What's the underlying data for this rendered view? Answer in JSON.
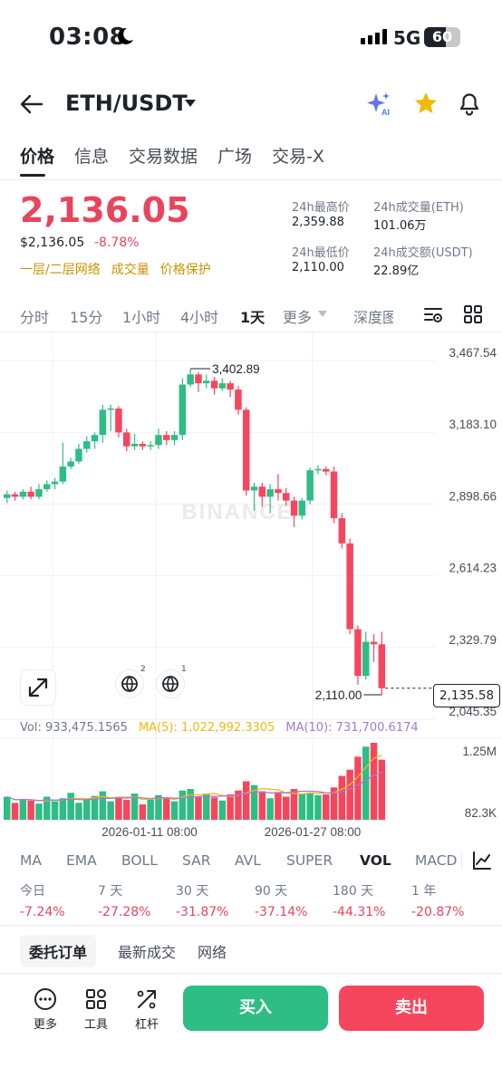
{
  "status_bar": {
    "time": "03:08",
    "network": "5G",
    "battery": "60",
    "battery_level": 0.6
  },
  "header": {
    "pair": "ETH/USDT"
  },
  "tabs": [
    {
      "label": "价格",
      "active": true
    },
    {
      "label": "信息"
    },
    {
      "label": "交易数据"
    },
    {
      "label": "广场"
    },
    {
      "label": "交易-X"
    }
  ],
  "price": {
    "last": "2,136.05",
    "usd": "$2,136.05",
    "change": "-8.78%",
    "tags": [
      "一层/二层网络",
      "成交量",
      "价格保护"
    ]
  },
  "stats": {
    "high_label": "24h最高价",
    "high": "2,359.88",
    "vol_eth_label": "24h成交量(ETH)",
    "vol_eth": "101.06万",
    "low_label": "24h最低价",
    "low": "2,110.00",
    "vol_usdt_label": "24h成交额(USDT)",
    "vol_usdt": "22.89亿"
  },
  "timeframes": [
    "分时",
    "15分",
    "1小时",
    "4小时",
    "1天",
    "更多",
    "深度图"
  ],
  "active_timeframe": "1天",
  "chart_data": {
    "type": "candlestick",
    "interval": "1天",
    "y_ticks": [
      "3,467.54",
      "3,183.10",
      "2,898.66",
      "2,614.23",
      "2,329.79",
      "2,045.35"
    ],
    "ylim": [
      2045.35,
      3467.54
    ],
    "x_ticks": [
      "2026-01-11 08:00",
      "2026-01-27 08:00"
    ],
    "high_marker": "3,402.89",
    "low_marker": "2,110.00",
    "current_price": "2,135.58",
    "watermark": "BINANCE",
    "candles": [
      [
        2890,
        2905,
        2870,
        2920
      ],
      [
        2905,
        2895,
        2880,
        2915
      ],
      [
        2895,
        2915,
        2885,
        2925
      ],
      [
        2915,
        2895,
        2885,
        2935
      ],
      [
        2895,
        2925,
        2885,
        2945
      ],
      [
        2925,
        2945,
        2915,
        2960
      ],
      [
        2945,
        2955,
        2925,
        2970
      ],
      [
        2955,
        3015,
        2945,
        3110
      ],
      [
        3015,
        3035,
        3005,
        3050
      ],
      [
        3035,
        3085,
        3025,
        3105
      ],
      [
        3085,
        3115,
        3070,
        3135
      ],
      [
        3115,
        3140,
        3085,
        3150
      ],
      [
        3140,
        3240,
        3110,
        3260
      ],
      [
        3240,
        3245,
        3155,
        3260
      ],
      [
        3245,
        3150,
        3130,
        3255
      ],
      [
        3150,
        3095,
        3075,
        3165
      ],
      [
        3095,
        3105,
        3080,
        3145
      ],
      [
        3105,
        3095,
        3080,
        3115
      ],
      [
        3095,
        3100,
        3080,
        3115
      ],
      [
        3100,
        3140,
        3085,
        3165
      ],
      [
        3140,
        3120,
        3100,
        3155
      ],
      [
        3120,
        3140,
        3100,
        3155
      ],
      [
        3140,
        3340,
        3120,
        3365
      ],
      [
        3340,
        3380,
        3330,
        3402.89
      ],
      [
        3380,
        3345,
        3310,
        3390
      ],
      [
        3345,
        3355,
        3325,
        3380
      ],
      [
        3355,
        3325,
        3300,
        3370
      ],
      [
        3325,
        3345,
        3315,
        3365
      ],
      [
        3345,
        3320,
        3290,
        3355
      ],
      [
        3320,
        3240,
        3220,
        3335
      ],
      [
        3240,
        2920,
        2900,
        3250
      ],
      [
        2920,
        2935,
        2840,
        2950
      ],
      [
        2935,
        2895,
        2855,
        2950
      ],
      [
        2895,
        2925,
        2830,
        2945
      ],
      [
        2925,
        2910,
        2880,
        2985
      ],
      [
        2910,
        2880,
        2860,
        2930
      ],
      [
        2880,
        2820,
        2775,
        2895
      ],
      [
        2820,
        2880,
        2805,
        2890
      ],
      [
        2880,
        3000,
        2865,
        3010
      ],
      [
        3000,
        3005,
        2985,
        3020
      ],
      [
        3005,
        2995,
        2980,
        3015
      ],
      [
        2995,
        2810,
        2790,
        3015
      ],
      [
        2810,
        2710,
        2690,
        2830
      ],
      [
        2710,
        2370,
        2350,
        2730
      ],
      [
        2370,
        2185,
        2150,
        2385
      ],
      [
        2185,
        2320,
        2170,
        2360
      ],
      [
        2320,
        2310,
        2240,
        2350
      ],
      [
        2310,
        2136.05,
        2110,
        2359.88
      ]
    ],
    "volume_ticks": [
      "1.25M",
      "82.3K"
    ],
    "volumes": [
      0.3,
      0.22,
      0.27,
      0.25,
      0.21,
      0.3,
      0.24,
      0.28,
      0.35,
      0.22,
      0.27,
      0.31,
      0.37,
      0.24,
      0.28,
      0.26,
      0.34,
      0.2,
      0.26,
      0.32,
      0.29,
      0.24,
      0.38,
      0.4,
      0.3,
      0.34,
      0.29,
      0.25,
      0.33,
      0.38,
      0.5,
      0.45,
      0.37,
      0.28,
      0.35,
      0.3,
      0.4,
      0.34,
      0.35,
      0.32,
      0.33,
      0.42,
      0.57,
      0.65,
      0.82,
      0.95,
      1.0,
      0.78
    ],
    "volume_max_label": "1.25M"
  },
  "indicators": {
    "vol": "Vol: 933,475.1565",
    "ma5": "MA(5): 1,022,992.3305",
    "ma10": "MA(10): 731,700.6174"
  },
  "indicator_tabs": [
    "MA",
    "EMA",
    "BOLL",
    "SAR",
    "AVL",
    "SUPER",
    "VOL",
    "MACD"
  ],
  "active_indicator": "VOL",
  "performance": [
    {
      "label": "今日",
      "value": "-7.24%"
    },
    {
      "label": "7 天",
      "value": "-27.28%"
    },
    {
      "label": "30 天",
      "value": "-31.87%"
    },
    {
      "label": "90 天",
      "value": "-37.14%"
    },
    {
      "label": "180 天",
      "value": "-44.31%"
    },
    {
      "label": "1 年",
      "value": "-20.87%"
    }
  ],
  "bottom_tabs": [
    "委托订单",
    "最新成交",
    "网络"
  ],
  "actions": [
    "更多",
    "工具",
    "杠杆"
  ],
  "buy_label": "买入",
  "sell_label": "卖出",
  "badges": {
    "a": "2",
    "b": "1"
  },
  "colors": {
    "up": "#2ebd85",
    "down": "#f6465d",
    "accent": "#f0b90b"
  }
}
